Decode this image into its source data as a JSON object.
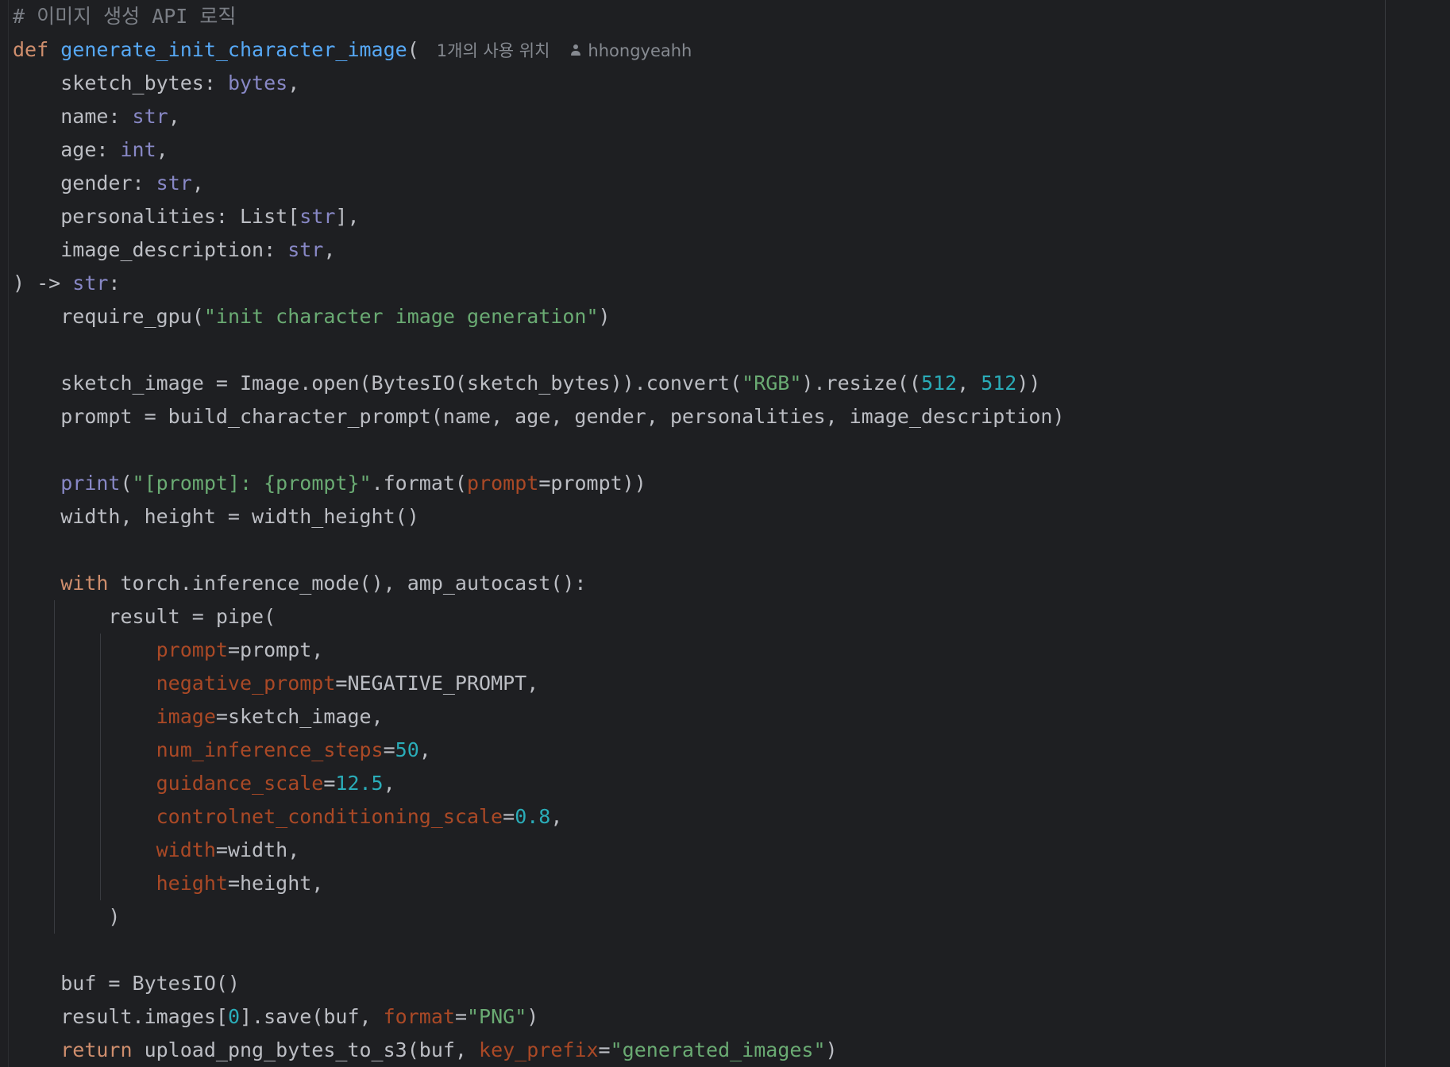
{
  "editor": {
    "comment": "# 이미지 생성 API 로직",
    "usages_hint": "1개의 사용 위치",
    "author_hint": "hhongyeahh",
    "code": {
      "def_kw": "def",
      "func_name": "generate_init_character_image",
      "open_paren": "(",
      "param_sketch_bytes": "sketch_bytes",
      "type_bytes": "bytes",
      "param_name": "name",
      "type_str": "str",
      "param_age": "age",
      "type_int": "int",
      "param_gender": "gender",
      "param_personalities": "personalities",
      "type_list": "List[",
      "param_image_description": "image_description",
      "return_arrow": ") -> ",
      "require_gpu": "require_gpu(",
      "require_gpu_arg": "\"init character image generation\"",
      "sketch_image_assign": "sketch_image = Image.open(BytesIO(sketch_bytes)).convert(",
      "rgb_str": "\"RGB\"",
      "resize_call": ").resize((",
      "size_512": "512",
      "prompt_assign": "prompt = build_character_prompt(name, age, gender, personalities, image_description)",
      "print_kw": "print",
      "print_str": "\"[prompt]: {prompt}\"",
      "format_call": ".format(",
      "kw_prompt": "prompt",
      "eq_prompt_close": "=prompt))",
      "width_height": "width, height = width_height()",
      "with_kw": "with",
      "with_rest": " torch.inference_mode(), amp_autocast():",
      "result_pipe": "result = pipe(",
      "arg_prompt_val": "=prompt,",
      "kw_negative_prompt": "negative_prompt",
      "arg_negative_val": "=NEGATIVE_PROMPT,",
      "kw_image": "image",
      "arg_image_val": "=sketch_image,",
      "kw_num_inference_steps": "num_inference_steps",
      "num_steps": "50",
      "kw_guidance_scale": "guidance_scale",
      "num_guidance": "12.5",
      "kw_controlnet": "controlnet_conditioning_scale",
      "num_controlnet": "0.8",
      "kw_width": "width",
      "arg_width_val": "=width,",
      "kw_height": "height",
      "arg_height_val": "=height,",
      "close_paren": ")",
      "buf_assign": "buf = BytesIO()",
      "save_start": "result.images[",
      "index_zero": "0",
      "save_mid": "].save(buf, ",
      "kw_format": "format",
      "png_str": "\"PNG\"",
      "return_kw": "return",
      "upload_call": " upload_png_bytes_to_s3(buf, ",
      "kw_key_prefix": "key_prefix",
      "generated_images_str": "\"generated_images\""
    }
  }
}
